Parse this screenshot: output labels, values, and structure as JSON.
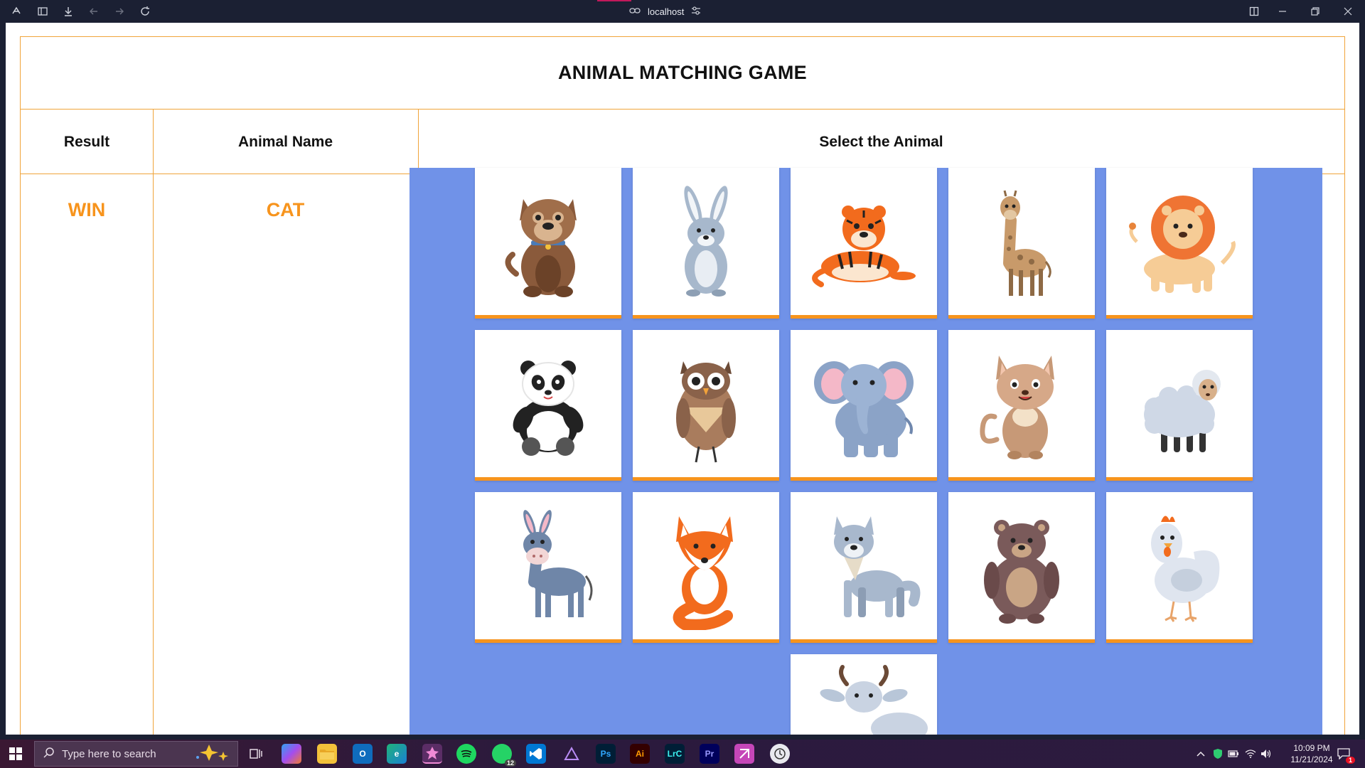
{
  "browser": {
    "address": "localhost"
  },
  "game": {
    "title": "ANIMAL MATCHING GAME",
    "headers": {
      "result": "Result",
      "animal_name": "Animal Name",
      "select": "Select the Animal"
    },
    "result_value": "WIN",
    "animal_name_value": "CAT",
    "animals": [
      "dog",
      "rabbit",
      "tiger",
      "giraffe",
      "lion",
      "panda",
      "owl",
      "elephant",
      "cat",
      "sheep",
      "donkey",
      "fox",
      "wolf",
      "bear",
      "chicken",
      "goat"
    ]
  },
  "taskbar": {
    "search_placeholder": "Type here to search",
    "time": "10:09 PM",
    "date": "11/21/2024",
    "whatsapp_badge": "12",
    "notification_badge": "1"
  },
  "colors": {
    "accent": "#f7941d",
    "border": "#f0a43a",
    "board": "#7092e8"
  }
}
